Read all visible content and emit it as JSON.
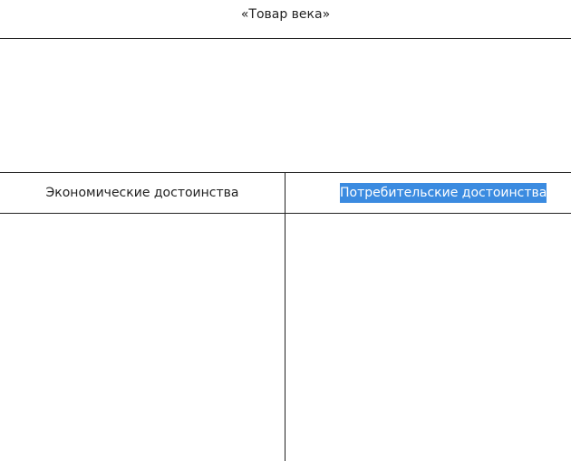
{
  "document": {
    "title": "«Товар века»",
    "table": {
      "columns": [
        {
          "header": "Экономические достоинства",
          "selected": false
        },
        {
          "header": "Потребительские достоинства",
          "selected": true
        }
      ],
      "highlight_color": "#3b8be0"
    }
  }
}
